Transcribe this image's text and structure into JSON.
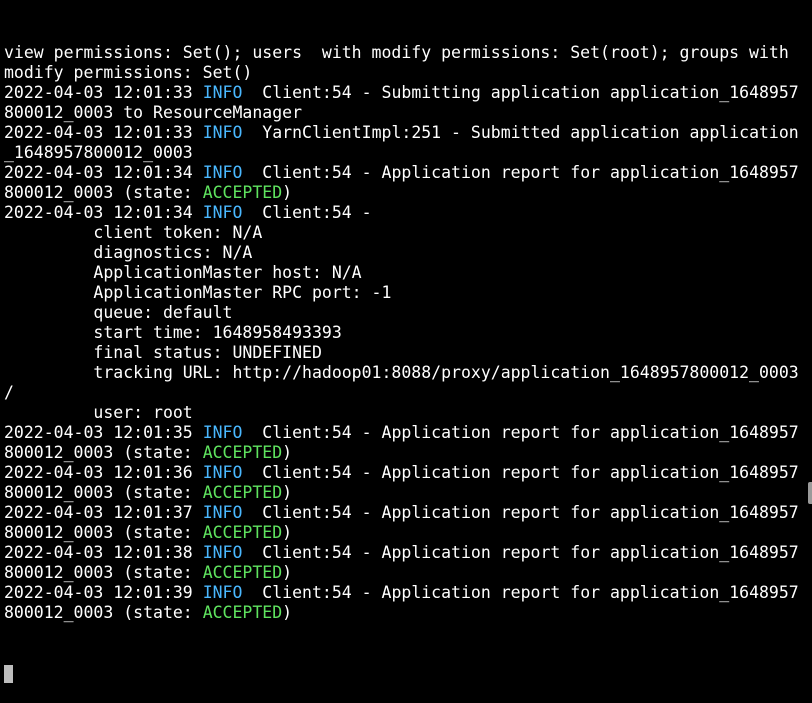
{
  "colors": {
    "background": "#000000",
    "text": "#ffffff",
    "info_level": "#4ab8ff",
    "state_accepted": "#5fe35f",
    "cursor": "#bdbdbd"
  },
  "terminal": {
    "lines": [
      {
        "parts": [
          {
            "t": "view permissions: Set(); users  with modify permissions: Set(root); groups with"
          }
        ]
      },
      {
        "parts": [
          {
            "t": "modify permissions: Set()"
          }
        ]
      },
      {
        "parts": [
          {
            "t": "2022-04-03 12:01:33 "
          },
          {
            "t": "INFO",
            "c": "info"
          },
          {
            "t": "  Client:54 - Submitting application application_1648957"
          }
        ]
      },
      {
        "parts": [
          {
            "t": "800012_0003 to ResourceManager"
          }
        ]
      },
      {
        "parts": [
          {
            "t": "2022-04-03 12:01:33 "
          },
          {
            "t": "INFO",
            "c": "info"
          },
          {
            "t": "  YarnClientImpl:251 - Submitted application application"
          }
        ]
      },
      {
        "parts": [
          {
            "t": "_1648957800012_0003"
          }
        ]
      },
      {
        "parts": [
          {
            "t": "2022-04-03 12:01:34 "
          },
          {
            "t": "INFO",
            "c": "info"
          },
          {
            "t": "  Client:54 - Application report for application_1648957"
          }
        ]
      },
      {
        "parts": [
          {
            "t": "800012_0003 (state: "
          },
          {
            "t": "ACCEPTED",
            "c": "accepted"
          },
          {
            "t": ")"
          }
        ]
      },
      {
        "parts": [
          {
            "t": "2022-04-03 12:01:34 "
          },
          {
            "t": "INFO",
            "c": "info"
          },
          {
            "t": "  Client:54 -"
          }
        ]
      },
      {
        "parts": [
          {
            "t": "         client token: N/A"
          }
        ]
      },
      {
        "parts": [
          {
            "t": "         diagnostics: N/A"
          }
        ]
      },
      {
        "parts": [
          {
            "t": "         ApplicationMaster host: N/A"
          }
        ]
      },
      {
        "parts": [
          {
            "t": "         ApplicationMaster RPC port: -1"
          }
        ]
      },
      {
        "parts": [
          {
            "t": "         queue: default"
          }
        ]
      },
      {
        "parts": [
          {
            "t": "         start time: 1648958493393"
          }
        ]
      },
      {
        "parts": [
          {
            "t": "         final status: UNDEFINED"
          }
        ]
      },
      {
        "parts": [
          {
            "t": "         tracking URL: http://hadoop01:8088/proxy/application_1648957800012_0003"
          }
        ]
      },
      {
        "parts": [
          {
            "t": "/"
          }
        ]
      },
      {
        "parts": [
          {
            "t": "         user: root"
          }
        ]
      },
      {
        "parts": [
          {
            "t": "2022-04-03 12:01:35 "
          },
          {
            "t": "INFO",
            "c": "info"
          },
          {
            "t": "  Client:54 - Application report for application_1648957"
          }
        ]
      },
      {
        "parts": [
          {
            "t": "800012_0003 (state: "
          },
          {
            "t": "ACCEPTED",
            "c": "accepted"
          },
          {
            "t": ")"
          }
        ]
      },
      {
        "parts": [
          {
            "t": "2022-04-03 12:01:36 "
          },
          {
            "t": "INFO",
            "c": "info"
          },
          {
            "t": "  Client:54 - Application report for application_1648957"
          }
        ]
      },
      {
        "parts": [
          {
            "t": "800012_0003 (state: "
          },
          {
            "t": "ACCEPTED",
            "c": "accepted"
          },
          {
            "t": ")"
          }
        ]
      },
      {
        "parts": [
          {
            "t": "2022-04-03 12:01:37 "
          },
          {
            "t": "INFO",
            "c": "info"
          },
          {
            "t": "  Client:54 - Application report for application_1648957"
          }
        ]
      },
      {
        "parts": [
          {
            "t": "800012_0003 (state: "
          },
          {
            "t": "ACCEPTED",
            "c": "accepted"
          },
          {
            "t": ")"
          }
        ]
      },
      {
        "parts": [
          {
            "t": "2022-04-03 12:01:38 "
          },
          {
            "t": "INFO",
            "c": "info"
          },
          {
            "t": "  Client:54 - Application report for application_1648957"
          }
        ]
      },
      {
        "parts": [
          {
            "t": "800012_0003 (state: "
          },
          {
            "t": "ACCEPTED",
            "c": "accepted"
          },
          {
            "t": ")"
          }
        ]
      },
      {
        "parts": [
          {
            "t": "2022-04-03 12:01:39 "
          },
          {
            "t": "INFO",
            "c": "info"
          },
          {
            "t": "  Client:54 - Application report for application_1648957"
          }
        ]
      },
      {
        "parts": [
          {
            "t": "800012_0003 (state: "
          },
          {
            "t": "ACCEPTED",
            "c": "accepted"
          },
          {
            "t": ")"
          }
        ]
      }
    ],
    "cursor": "block-cursor"
  }
}
